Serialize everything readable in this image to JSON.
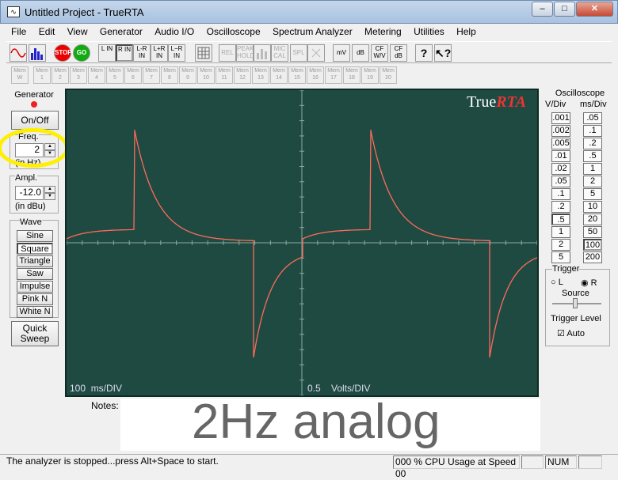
{
  "window": {
    "title": "Untitled Project - TrueRTA",
    "minimize": "–",
    "maximize": "□",
    "close": "✕"
  },
  "menu": [
    "File",
    "Edit",
    "View",
    "Generator",
    "Audio I/O",
    "Oscilloscope",
    "Spectrum Analyzer",
    "Metering",
    "Utilities",
    "Help"
  ],
  "toolbar": {
    "stop": "STOP",
    "go": "GO",
    "l_in": "L IN",
    "r_in": "R IN",
    "lr_in": "L-R IN",
    "lpr_in": "L+R IN",
    "lmr_in": "L−R IN",
    "rel": "REL",
    "peak_hold": "PEAK HOLD",
    "mic_cal": "MIC CAL",
    "spl": "SPL",
    "mv": "mV",
    "db": "dB",
    "cf_wv": "CF W/V",
    "cf_db": "CF dB"
  },
  "memory": {
    "mem_w": "Mem W",
    "slots": [
      "1",
      "2",
      "3",
      "4",
      "5",
      "6",
      "7",
      "8",
      "9",
      "10",
      "11",
      "12",
      "13",
      "14",
      "15",
      "16",
      "17",
      "18",
      "19",
      "20"
    ],
    "prefix": "Mem"
  },
  "generator": {
    "header": "Generator",
    "on_off": "On/Off",
    "freq_label": "Freq.",
    "freq_value": "2",
    "freq_unit": "(in Hz)",
    "ampl_label": "Ampl.",
    "ampl_value": "-12.0",
    "ampl_unit": "(in dBu)",
    "wave_label": "Wave",
    "waves": [
      "Sine",
      "Square",
      "Triangle",
      "Saw",
      "Impulse",
      "Pink N",
      "White N"
    ],
    "quick_sweep": "Quick Sweep"
  },
  "plot": {
    "brand_true": "True",
    "brand_rta": "RTA",
    "x_label": "100  ms/DIV",
    "y_label": "0.5    Volts/DIV"
  },
  "oscilloscope": {
    "header": "Oscilloscope",
    "vdiv_label": "V/Div",
    "msdiv_label": "ms/Div",
    "vdiv": [
      ".001",
      ".002",
      ".005",
      ".01",
      ".02",
      ".05",
      ".1",
      ".2",
      ".5",
      "1",
      "2",
      "5"
    ],
    "msdiv": [
      ".05",
      ".1",
      ".2",
      ".5",
      "1",
      "2",
      "5",
      "10",
      "20",
      "50",
      "100",
      "200"
    ],
    "vdiv_selected": ".5",
    "msdiv_selected": "100"
  },
  "trigger": {
    "header": "Trigger",
    "l": "L",
    "r": "R",
    "source": "Source",
    "level": "Trigger Level",
    "auto": "Auto"
  },
  "notes": {
    "label": "Notes:",
    "text": "2Hz analog"
  },
  "status": {
    "message": "The analyzer is stopped...press Alt+Space to start.",
    "cpu": "000 % CPU Usage at Speed 00",
    "num": "NUM"
  }
}
